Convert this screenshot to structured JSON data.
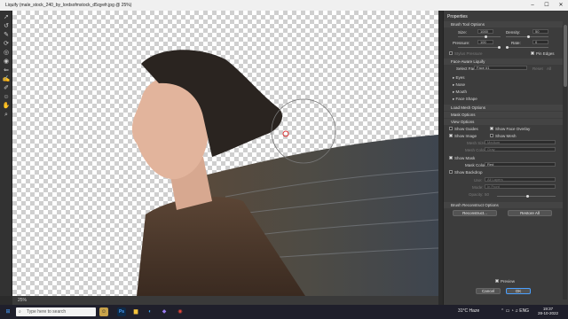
{
  "window": {
    "title": "Liquify (male_stock_240_by_lordsofmstock_d5qyefr.jpg @ 25%)",
    "ctrl_min": "–",
    "ctrl_max": "☐",
    "ctrl_close": "✕"
  },
  "status": {
    "zoom": "25%"
  },
  "panel": {
    "title": "Properties",
    "brush_tool_options": {
      "label": "Brush Tool Options",
      "size_label": "Size:",
      "size_value": "1000",
      "density_label": "Density:",
      "density_value": "50",
      "pressure_label": "Pressure:",
      "pressure_value": "100",
      "rate_label": "Rate:",
      "rate_value": "0",
      "stylus_pressure_label": "Stylus Pressure",
      "pin_edges_label": "Pin Edges",
      "pin_edges_checked": true
    },
    "face_aware": {
      "label": "Face-Aware Liquify",
      "select_face_label": "Select Face:",
      "select_face_value": "Face #1",
      "reset_label": "Reset",
      "all_label": "All",
      "items": [
        "Eyes",
        "Nose",
        "Mouth",
        "Face Shape"
      ]
    },
    "load_mesh_label": "Load Mesh Options",
    "mask_options_label": "Mask Options",
    "view_options": {
      "label": "View Options",
      "show_guides_label": "Show Guides",
      "show_face_overlay_label": "Show Face Overlay",
      "show_image_label": "Show Image",
      "show_mesh_label": "Show Mesh",
      "mesh_size_label": "Mesh Size:",
      "mesh_size_value": "Medium",
      "mesh_color_label": "Mesh Color:",
      "mesh_color_value": "Gray",
      "show_mask_label": "Show Mask",
      "mask_color_label": "Mask Color:",
      "mask_color_value": "Red",
      "show_backdrop_label": "Show Backdrop",
      "use_label": "Use:",
      "use_value": "All Layers",
      "mode_label": "Mode:",
      "mode_value": "In Front",
      "opacity_label": "Opacity:",
      "opacity_value": "50"
    },
    "reconstruct": {
      "label": "Brush Reconstruct Options",
      "reconstruct_button": "Reconstruct...",
      "restore_all_button": "Restore All"
    },
    "preview_label": "Preview",
    "cancel_button": "Cancel",
    "ok_button": "OK"
  },
  "taskbar": {
    "search_placeholder": "Type here to search",
    "weather": "31°C  Haze",
    "time": "19:37",
    "date": "28-10-2022"
  },
  "colors": {
    "accent": "#4aa0ff",
    "panel_bg": "#3c3c3c",
    "canvas_bg": "#4a4a4a"
  }
}
